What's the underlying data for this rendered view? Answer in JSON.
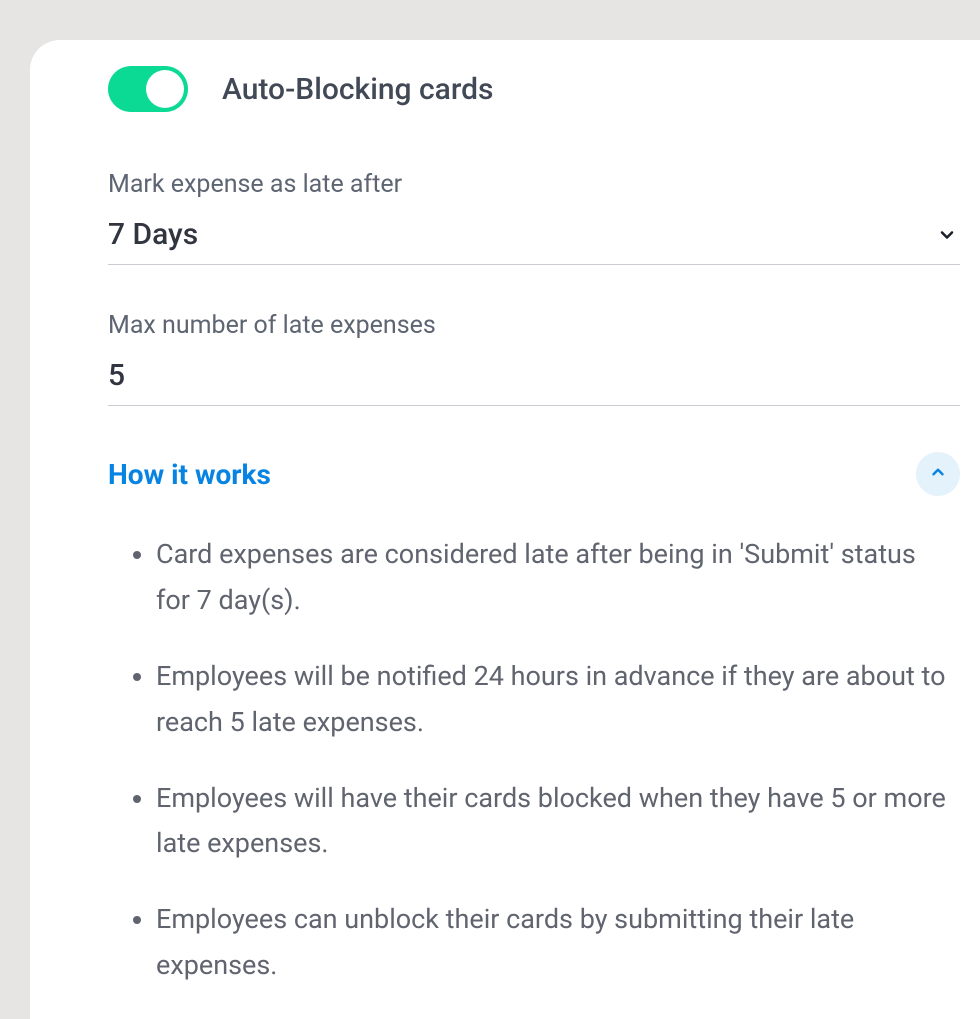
{
  "toggle": {
    "label": "Auto-Blocking cards",
    "on": true
  },
  "late_after": {
    "label": "Mark expense as late after",
    "value": "7 Days"
  },
  "max_late": {
    "label": "Max number of late expenses",
    "value": "5"
  },
  "how": {
    "label": "How it works",
    "items": [
      "Card expenses are considered late after being in 'Submit' status for 7 day(s).",
      "Employees will be notified 24 hours in advance if they are about to reach 5 late expenses.",
      "Employees will have their cards blocked when they have 5 or more late expenses.",
      "Employees can unblock their cards by submitting their late expenses."
    ]
  }
}
